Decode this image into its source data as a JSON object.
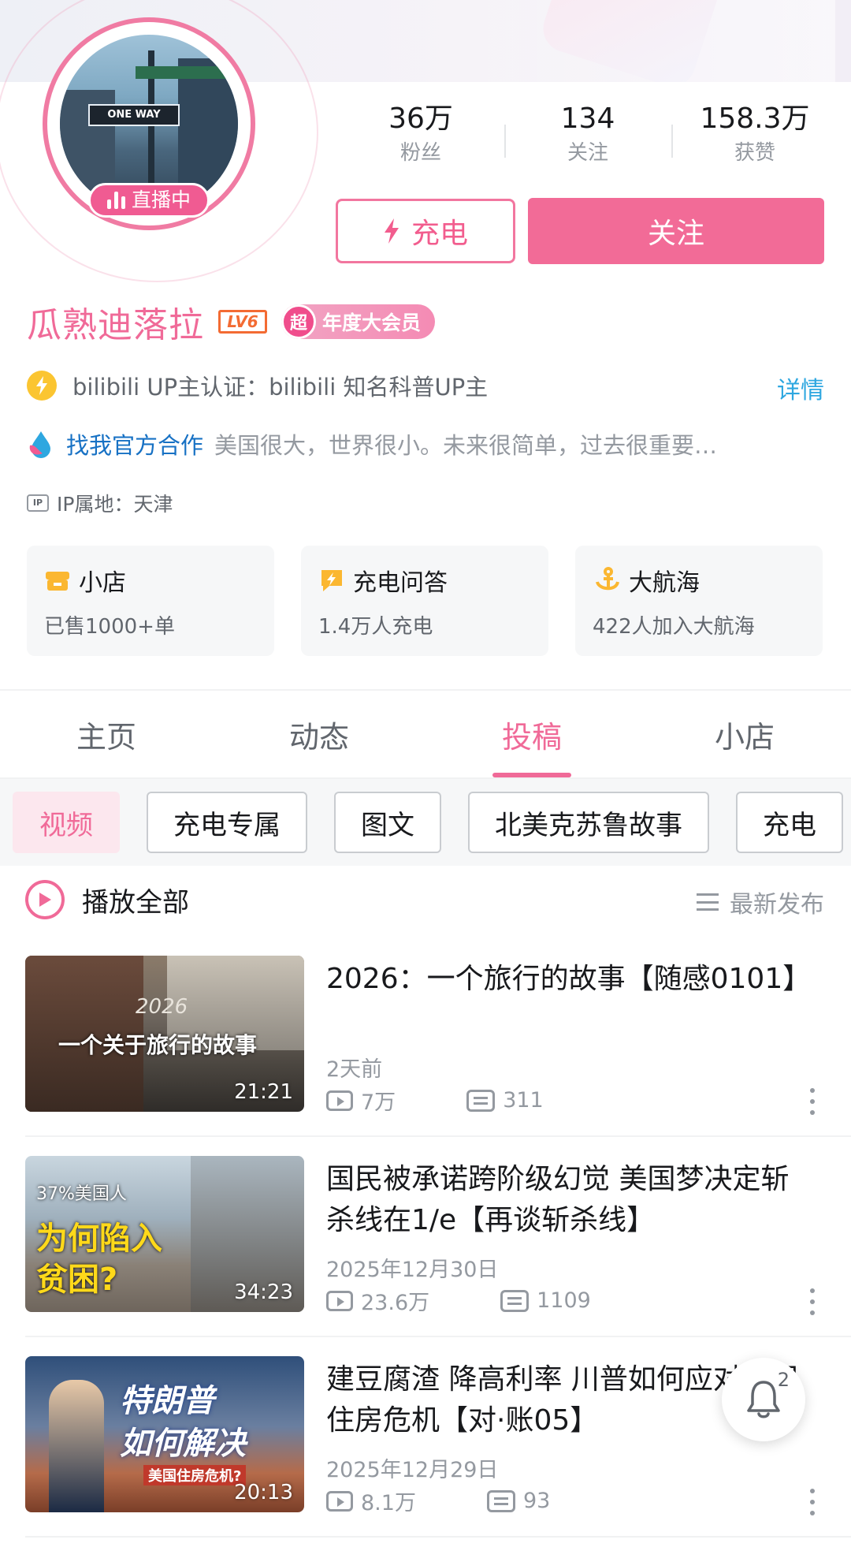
{
  "profile": {
    "live_label": "直播中",
    "username": "瓜熟迪落拉",
    "level": "LV6",
    "vip_mark": "超",
    "vip_label": "年度大会员",
    "avatar_sign": "ONE WAY"
  },
  "stats": [
    {
      "value": "36万",
      "label": "粉丝"
    },
    {
      "value": "134",
      "label": "关注"
    },
    {
      "value": "158.3万",
      "label": "获赞"
    }
  ],
  "actions": {
    "charge_label": "充电",
    "follow_label": "关注"
  },
  "verification": {
    "text": "bilibili UP主认证：bilibili 知名科普UP主",
    "detail_label": "详情"
  },
  "cooperation": {
    "link": "找我官方合作",
    "bio": "美国很大，世界很小。未来很简单，过去很重要…"
  },
  "ip": {
    "icon_text": "IP",
    "text": "IP属地：天津"
  },
  "cards": [
    {
      "title": "小店",
      "subtitle": "已售1000+单",
      "icon": "shop-icon",
      "color": "#fbb731"
    },
    {
      "title": "充电问答",
      "subtitle": "1.4万人充电",
      "icon": "charge-qa-icon",
      "color": "#fbb731"
    },
    {
      "title": "大航海",
      "subtitle": "422人加入大航海",
      "icon": "anchor-icon",
      "color": "#fbb731"
    }
  ],
  "tabs": [
    "主页",
    "动态",
    "投稿",
    "小店"
  ],
  "active_tab": "投稿",
  "chips": [
    "视频",
    "充电专属",
    "图文",
    "北美克苏鲁故事",
    "充电"
  ],
  "list_header": {
    "play_all": "播放全部",
    "sort": "最新发布"
  },
  "videos": [
    {
      "title": "2026：一个旅行的故事【随感0101】",
      "date": "2天前",
      "views": "7万",
      "comments": "311",
      "duration": "21:21",
      "thumb_text": "一个关于旅行的故事",
      "thumb_overlay": "2026"
    },
    {
      "title": "国民被承诺跨阶级幻觉 美国梦决定斩杀线在1/e【再谈斩杀线】",
      "date": "2025年12月30日",
      "views": "23.6万",
      "comments": "1109",
      "duration": "34:23",
      "thumb_small": "37%美国人",
      "thumb_big1": "为何陷入",
      "thumb_big2": "贫困?"
    },
    {
      "title": "建豆腐渣 降高利率 川普如何应对美国住房危机【对·账05】",
      "date": "2025年12月29日",
      "views": "8.1万",
      "comments": "93",
      "duration": "20:13",
      "thumb_big1": "特朗普",
      "thumb_big2": "如何解决",
      "thumb_small": "美国住房危机?"
    }
  ],
  "bell": {
    "count": "2"
  },
  "colors": {
    "accent": "#f06a98",
    "follow_bg": "#f26b97",
    "link_blue": "#1771c4"
  }
}
